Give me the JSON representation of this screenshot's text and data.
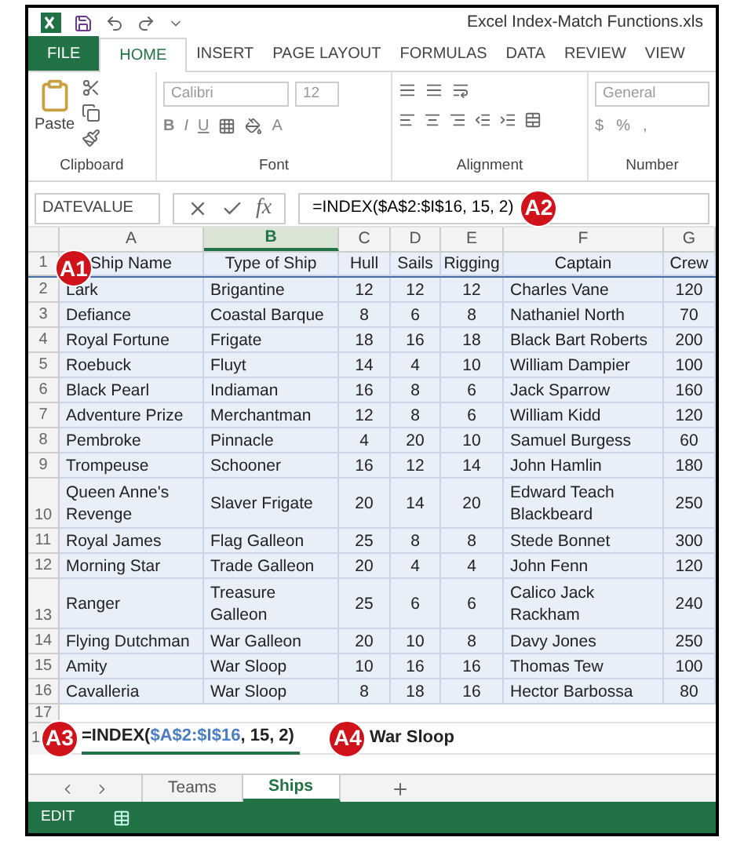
{
  "window": {
    "title": "Excel Index-Match Functions.xls"
  },
  "ribbon_tabs": [
    {
      "label": "FILE",
      "kind": "file",
      "selected": false
    },
    {
      "label": "HOME",
      "kind": "tab",
      "selected": true
    },
    {
      "label": "INSERT",
      "kind": "tab",
      "selected": false
    },
    {
      "label": "PAGE LAYOUT",
      "kind": "tab",
      "selected": false
    },
    {
      "label": "FORMULAS",
      "kind": "tab",
      "selected": false
    },
    {
      "label": "DATA",
      "kind": "tab",
      "selected": false
    },
    {
      "label": "REVIEW",
      "kind": "tab",
      "selected": false
    },
    {
      "label": "VIEW",
      "kind": "tab",
      "selected": false
    }
  ],
  "ribbon": {
    "clipboard": {
      "paste": "Paste",
      "label": "Clipboard"
    },
    "font": {
      "font_name": "Calibri",
      "font_size": "12",
      "bold": "B",
      "italic": "I",
      "underline": "U",
      "font_color": "A",
      "label": "Font"
    },
    "alignment": {
      "label": "Alignment"
    },
    "number": {
      "format": "General",
      "currency": "$",
      "percent": "%",
      "comma": ",",
      "label": "Number"
    }
  },
  "formula_bar": {
    "name_box": "DATEVALUE",
    "fx": "fx",
    "formula": "=INDEX($A$2:$I$16, 15, 2)",
    "callout": "A2"
  },
  "columns": [
    {
      "label": "A",
      "selected": false
    },
    {
      "label": "B",
      "selected": true
    },
    {
      "label": "C",
      "selected": false
    },
    {
      "label": "D",
      "selected": false
    },
    {
      "label": "E",
      "selected": false
    },
    {
      "label": "F",
      "selected": false
    },
    {
      "label": "G",
      "selected": false
    }
  ],
  "table_callout": "A1",
  "rows": [
    {
      "number": "1",
      "cells": [
        "Ship Name",
        "Type of Ship",
        "Hull",
        "Sails",
        "Rigging",
        "Captain",
        "Crew"
      ]
    },
    {
      "number": "2",
      "cells": [
        "Lark",
        "Brigantine",
        "12",
        "12",
        "12",
        "Charles Vane",
        "120"
      ]
    },
    {
      "number": "3",
      "cells": [
        "Defiance",
        "Coastal Barque",
        "8",
        "6",
        "8",
        "Nathaniel North",
        "70"
      ]
    },
    {
      "number": "4",
      "cells": [
        "Royal Fortune",
        "Frigate",
        "18",
        "16",
        "18",
        "Black Bart Roberts",
        "200"
      ]
    },
    {
      "number": "5",
      "cells": [
        "Roebuck",
        "Fluyt",
        "14",
        "4",
        "10",
        "William Dampier",
        "100"
      ]
    },
    {
      "number": "6",
      "cells": [
        "Black Pearl",
        "Indiaman",
        "16",
        "8",
        "6",
        "Jack Sparrow",
        "160"
      ]
    },
    {
      "number": "7",
      "cells": [
        "Adventure Prize",
        "Merchantman",
        "12",
        "8",
        "6",
        "William Kidd",
        "120"
      ]
    },
    {
      "number": "8",
      "cells": [
        "Pembroke",
        "Pinnacle",
        "4",
        "20",
        "10",
        "Samuel Burgess",
        "60"
      ]
    },
    {
      "number": "9",
      "cells": [
        "Trompeuse",
        "Schooner",
        "16",
        "12",
        "14",
        "John Hamlin",
        "180"
      ]
    },
    {
      "number": "10",
      "cells": [
        "Queen Anne's\nRevenge",
        "Slaver Frigate",
        "20",
        "14",
        "20",
        "Edward Teach\nBlackbeard",
        "250"
      ]
    },
    {
      "number": "11",
      "cells": [
        "Royal James",
        "Flag Galleon",
        "25",
        "8",
        "8",
        "Stede Bonnet",
        "300"
      ]
    },
    {
      "number": "12",
      "cells": [
        "Morning Star",
        "Trade Galleon",
        "20",
        "4",
        "4",
        "John Fenn",
        "120"
      ]
    },
    {
      "number": "13",
      "cells": [
        "Ranger",
        "Treasure\nGalleon",
        "25",
        "6",
        "6",
        "Calico Jack\nRackham",
        "240"
      ]
    },
    {
      "number": "14",
      "cells": [
        "Flying Dutchman",
        "War Galleon",
        "20",
        "10",
        "8",
        "Davy Jones",
        "250"
      ]
    },
    {
      "number": "15",
      "cells": [
        "Amity",
        "War Sloop",
        "10",
        "16",
        "16",
        "Thomas Tew",
        "100"
      ]
    },
    {
      "number": "16",
      "cells": [
        "Cavalleria",
        "War Sloop",
        "8",
        "18",
        "16",
        "Hector Barbossa",
        "80"
      ]
    }
  ],
  "empty_row": {
    "number": "17"
  },
  "edit_row": {
    "number": "1",
    "callout": "A3",
    "formula_parts": [
      {
        "text": "=INDEX(",
        "kind": "text"
      },
      {
        "text": "$A$2:$I$16",
        "kind": "reference"
      },
      {
        "text": ", 15, 2)",
        "kind": "text"
      }
    ],
    "result_callout": "A4",
    "result": "War Sloop"
  },
  "sheet_tabs": [
    {
      "label": "Teams",
      "selected": false
    },
    {
      "label": "Ships",
      "selected": true
    }
  ],
  "status_bar": {
    "mode": "EDIT"
  }
}
